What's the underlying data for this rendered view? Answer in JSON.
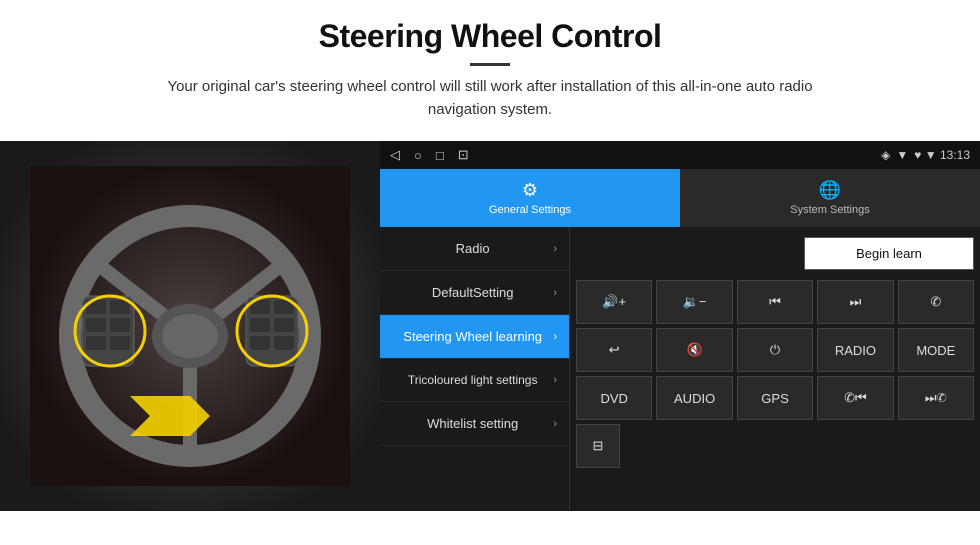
{
  "header": {
    "title": "Steering Wheel Control",
    "divider": true,
    "subtitle": "Your original car's steering wheel control will still work after installation of this all-in-one auto radio navigation system."
  },
  "statusBar": {
    "icons": [
      "◁",
      "○",
      "□",
      "⊡"
    ],
    "rightText": "♥ ▼ 13:13"
  },
  "tabs": [
    {
      "id": "general",
      "label": "General Settings",
      "active": true
    },
    {
      "id": "system",
      "label": "System Settings",
      "active": false
    }
  ],
  "menuItems": [
    {
      "id": "radio",
      "label": "Radio",
      "active": false
    },
    {
      "id": "defaultsetting",
      "label": "DefaultSetting",
      "active": false
    },
    {
      "id": "steering",
      "label": "Steering Wheel learning",
      "active": true
    },
    {
      "id": "tricoloured",
      "label": "Tricoloured light settings",
      "active": false
    },
    {
      "id": "whitelist",
      "label": "Whitelist setting",
      "active": false
    }
  ],
  "beginLearnBtn": "Begin learn",
  "controlRows": [
    [
      {
        "id": "vol-up",
        "label": "🔊+",
        "type": "icon"
      },
      {
        "id": "vol-down",
        "label": "🔉−",
        "type": "icon"
      },
      {
        "id": "prev",
        "label": "⏮",
        "type": "icon"
      },
      {
        "id": "next",
        "label": "⏭",
        "type": "icon"
      },
      {
        "id": "phone",
        "label": "✆",
        "type": "icon"
      }
    ],
    [
      {
        "id": "hang",
        "label": "↩",
        "type": "icon"
      },
      {
        "id": "mute",
        "label": "🔇",
        "type": "icon"
      },
      {
        "id": "power",
        "label": "⏻",
        "type": "icon"
      },
      {
        "id": "radio-btn",
        "label": "RADIO",
        "type": "text"
      },
      {
        "id": "mode-btn",
        "label": "MODE",
        "type": "text"
      }
    ],
    [
      {
        "id": "dvd",
        "label": "DVD",
        "type": "text"
      },
      {
        "id": "audio",
        "label": "AUDIO",
        "type": "text"
      },
      {
        "id": "gps",
        "label": "GPS",
        "type": "text"
      },
      {
        "id": "tel-prev",
        "label": "✆⏮",
        "type": "icon"
      },
      {
        "id": "tel-next",
        "label": "⏭✆",
        "type": "icon"
      }
    ]
  ],
  "bottomRow": [
    {
      "id": "settings-icon-btn",
      "label": "⚙",
      "type": "icon"
    }
  ]
}
